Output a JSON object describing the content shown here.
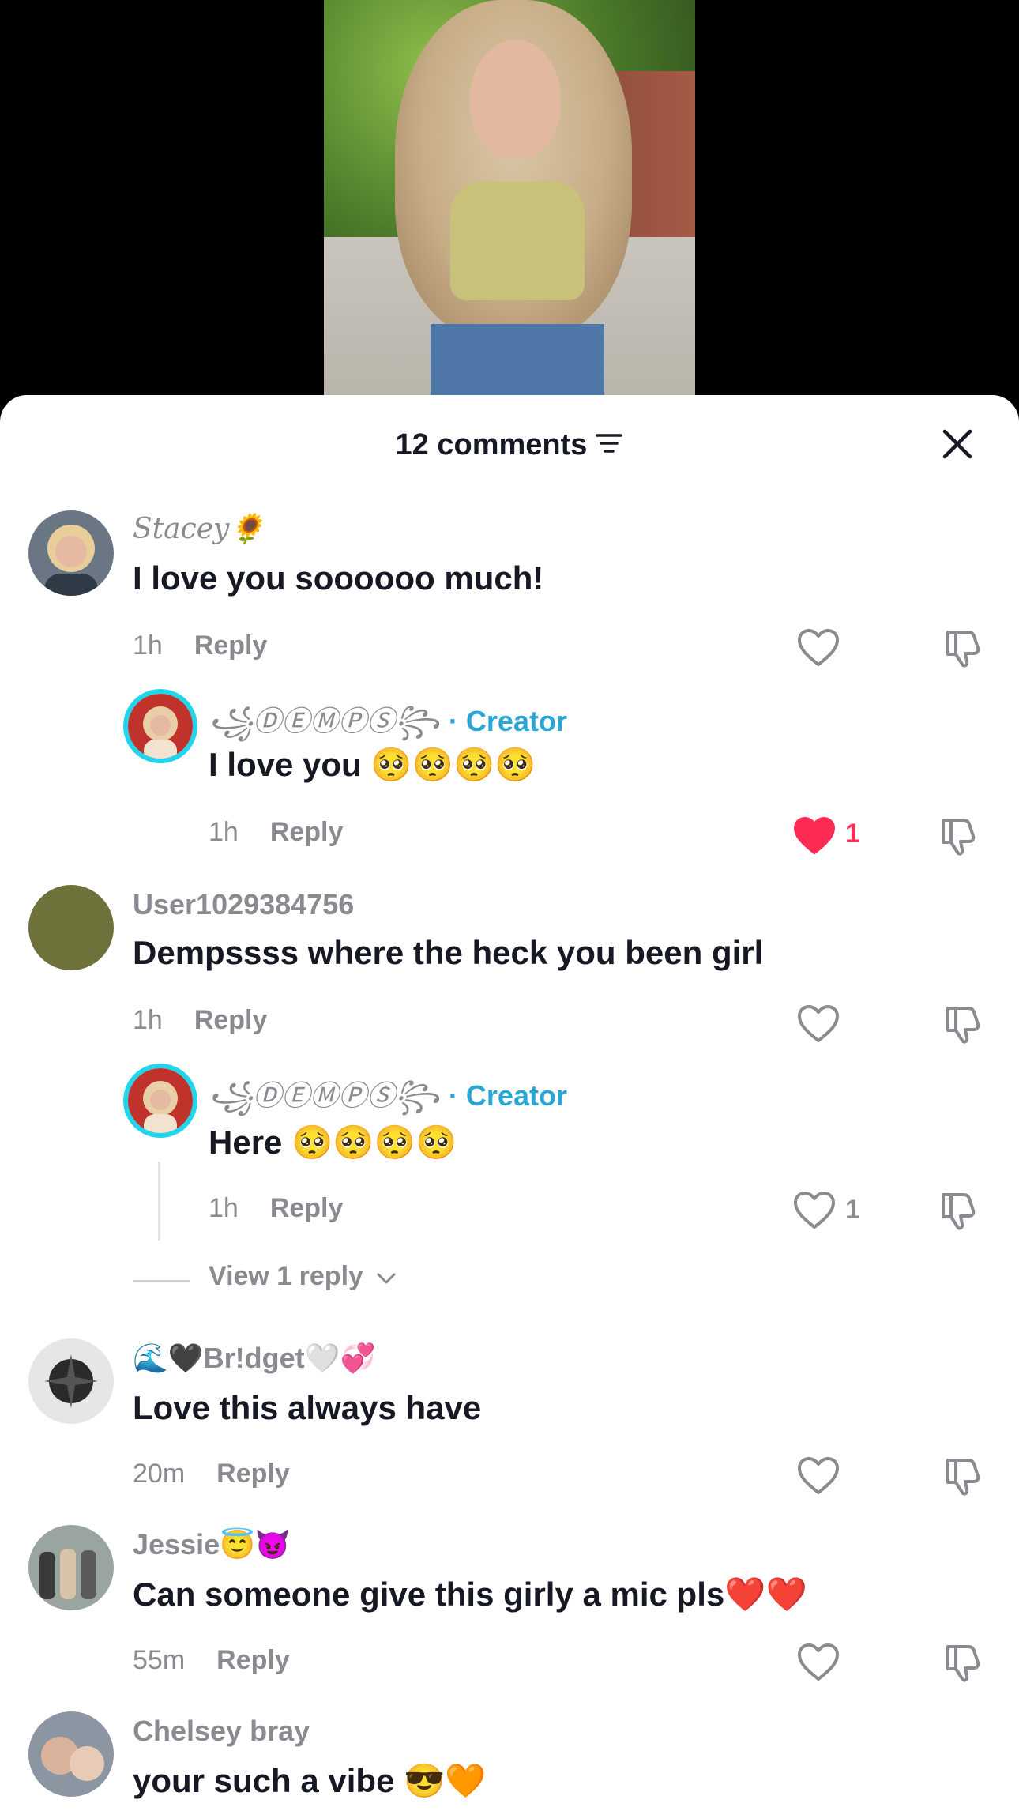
{
  "header": {
    "comment_count": "12 comments"
  },
  "comments": [
    {
      "user": "Stacey🌻",
      "text": "I love you soooooo much!",
      "time": "1h",
      "reply": "Reply",
      "likes": "",
      "reply_item": {
        "user": "꧁ⒹⒺⓂⓅⓈ꧂",
        "creator_label": "· Creator",
        "text": "I love you 🥺🥺🥺🥺",
        "time": "1h",
        "reply": "Reply",
        "likes": "1",
        "liked": true
      }
    },
    {
      "user": "User1029384756",
      "text": "Dempssss where the heck you been girl",
      "time": "1h",
      "reply": "Reply",
      "likes": "",
      "reply_item": {
        "user": "꧁ⒹⒺⓂⓅⓈ꧂",
        "creator_label": "· Creator",
        "text": "Here 🥺🥺🥺🥺",
        "time": "1h",
        "reply": "Reply",
        "likes": "1",
        "liked": false
      },
      "view_replies": "View 1 reply"
    },
    {
      "user": "🌊🖤Br!dget🤍💞",
      "text": "Love this always have",
      "time": "20m",
      "reply": "Reply",
      "likes": ""
    },
    {
      "user": "Jessie😇😈",
      "text": "Can someone give this girly a mic pls❤️❤️",
      "time": "55m",
      "reply": "Reply",
      "likes": ""
    },
    {
      "user": "Chelsey bray",
      "text": "your such a vibe 😎🧡"
    }
  ],
  "colors": {
    "accent_like": "#fe2c55",
    "creator_ring": "#20d5ec",
    "creator_text": "#2aa6d6"
  },
  "icons": [
    "sort-icon",
    "close-icon",
    "heart-icon",
    "dislike-icon",
    "chevron-down-icon"
  ]
}
